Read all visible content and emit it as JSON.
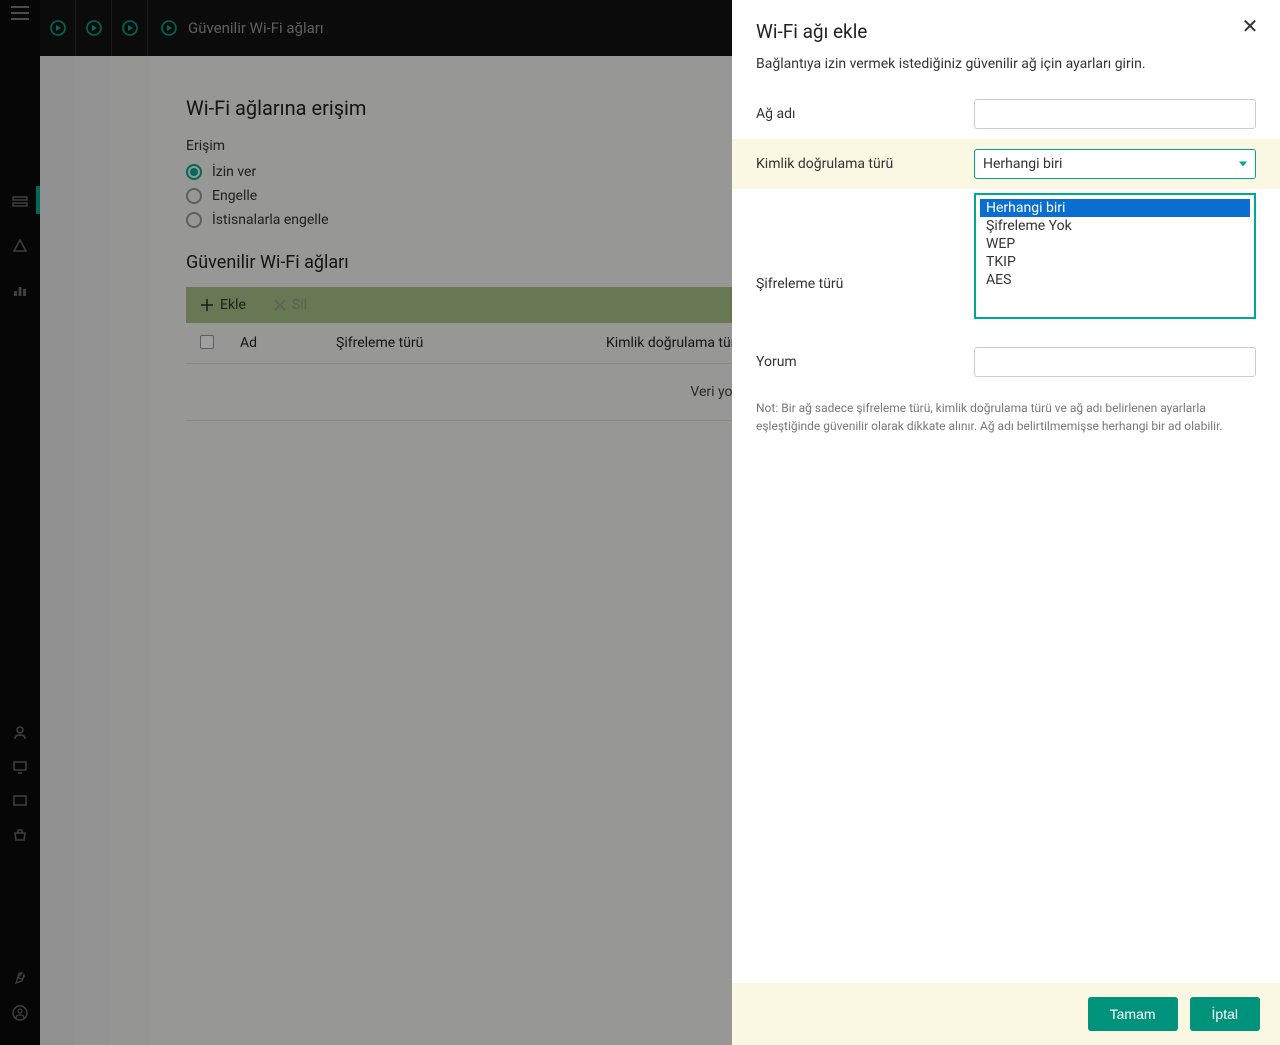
{
  "topbar": {
    "title": "Güvenilir Wi-Fi ağları"
  },
  "main": {
    "heading": "Wi-Fi ağlarına erişim",
    "access_label": "Erişim",
    "radios": {
      "allow": "İzin ver",
      "block": "Engelle",
      "block_exceptions": "İstisnalarla engelle"
    },
    "trusted_heading": "Güvenilir Wi-Fi ağları",
    "toolbar": {
      "add": "Ekle",
      "delete": "Sil"
    },
    "columns": {
      "name": "Ad",
      "encryption": "Şifreleme türü",
      "auth": "Kimlik doğrulama türü"
    },
    "empty": "Veri yok"
  },
  "panel": {
    "title": "Wi-Fi ağı ekle",
    "desc": "Bağlantıya izin vermek istediğiniz güvenilir ağ için ayarları girin.",
    "fields": {
      "network_name": "Ağ adı",
      "auth_type": "Kimlik doğrulama türü",
      "encryption_type": "Şifreleme türü",
      "comment": "Yorum"
    },
    "auth_selected": "Herhangi biri",
    "auth_options": [
      "Herhangi biri",
      "Şifreleme Yok",
      "WEP",
      "TKIP",
      "AES"
    ],
    "note": "Not: Bir ağ sadece şifreleme türü, kimlik doğrulama türü ve ağ adı belirlenen ayarlarla eşleştiğinde güvenilir olarak dikkate alınır. Ağ adı belirtilmemişse herhangi bir ad olabilir.",
    "ok": "Tamam",
    "cancel": "İptal"
  }
}
